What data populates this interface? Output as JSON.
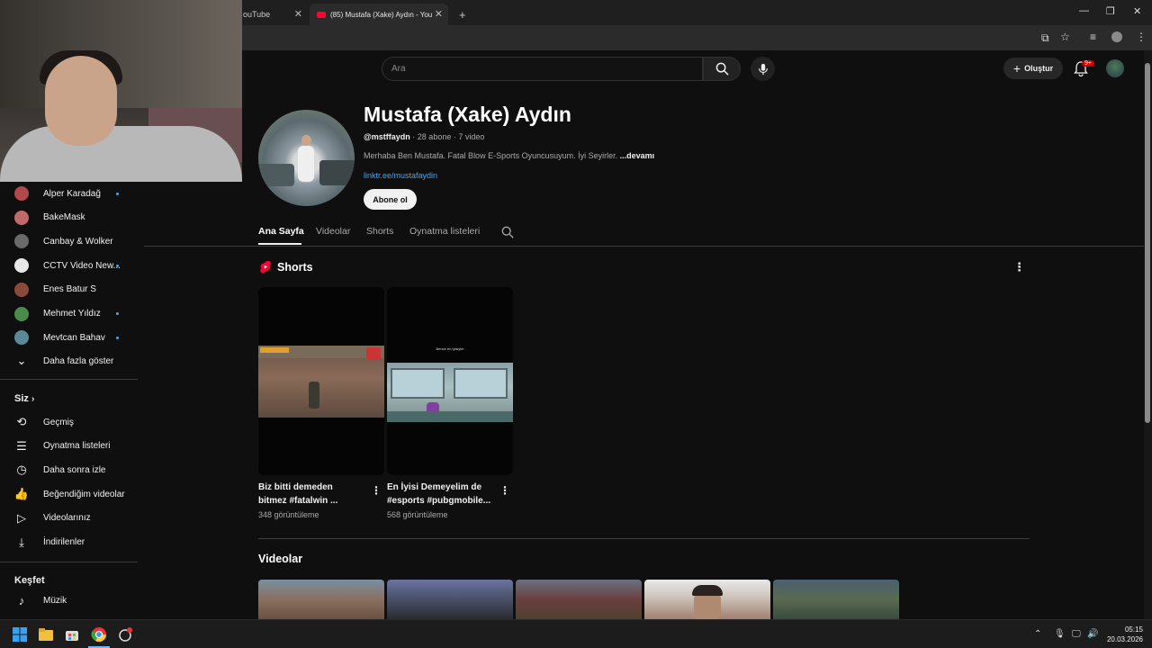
{
  "browser": {
    "tabs": [
      {
        "title": "ouTube",
        "active": false
      },
      {
        "title": "(85) Mustafa (Xake) Aydın - You",
        "active": true
      }
    ],
    "new_tab_symbol": "+",
    "window_controls": [
      "minimize-icon",
      "restore-icon",
      "close-icon"
    ]
  },
  "header": {
    "search_placeholder": "Ara",
    "create_label": "Oluştur",
    "notification_badge": "9+"
  },
  "sidebar": {
    "subscriptions": [
      {
        "label": "Alper Karadağ",
        "new": true,
        "color": "#b04a4a"
      },
      {
        "label": "BakeMask",
        "new": false,
        "color": "#c06a6a"
      },
      {
        "label": "Canbay & Wolker",
        "new": false,
        "color": "#6a6a6a"
      },
      {
        "label": "CCTV Video New...",
        "new": true,
        "color": "#e8e8e8"
      },
      {
        "label": "Enes Batur S",
        "new": false,
        "color": "#8a4a3a"
      },
      {
        "label": "Mehmet Yıldız",
        "new": true,
        "color": "#4a8a4a"
      },
      {
        "label": "Mevtcan Bahav",
        "new": true,
        "color": "#5a8a9a"
      }
    ],
    "show_more": "Daha fazla göster",
    "you_heading": "Siz",
    "you_items": [
      {
        "label": "Geçmiş",
        "icon": "history-icon"
      },
      {
        "label": "Oynatma listeleri",
        "icon": "playlists-icon"
      },
      {
        "label": "Daha sonra izle",
        "icon": "watch-later-icon"
      },
      {
        "label": "Beğendiğim videolar",
        "icon": "like-icon"
      },
      {
        "label": "Videolarınız",
        "icon": "your-videos-icon"
      },
      {
        "label": "İndirilenler",
        "icon": "download-icon"
      }
    ],
    "explore_heading": "Keşfet",
    "explore_items": [
      {
        "label": "Müzik",
        "icon": "music-icon"
      }
    ]
  },
  "channel": {
    "name": "Mustafa (Xake) Aydın",
    "handle": "@mstffaydn",
    "subscribers": "28 abone",
    "videos": "7 video",
    "description": "Merhaba Ben Mustafa. Fatal Blow E-Sports Oyuncusuyum. İyi Seyirler.",
    "more": "...devamı",
    "link": "linktr.ee/mustafaydin",
    "subscribe_label": "Abone ol",
    "tabs": [
      "Ana Sayfa",
      "Videolar",
      "Shorts",
      "Oynatma listeleri"
    ],
    "active_tab": "Ana Sayfa"
  },
  "shorts_section": {
    "title": "Shorts",
    "items": [
      {
        "title_line1": "Biz bitti demeden",
        "title_line2": "bitmez #fatalwin ...",
        "views": "348 görüntüleme"
      },
      {
        "title_line1": "En İyisi Demeyelim de",
        "title_line2": "#esports #pubgmobile...",
        "views": "568 görüntüleme",
        "overlay": "Bence en iyisiyim"
      }
    ]
  },
  "videos_section": {
    "title": "Videolar"
  },
  "taskbar": {
    "time": "05:15",
    "date": "20.03.2026"
  },
  "colors": {
    "background": "#0f0f0f",
    "accent_red": "#ff0033",
    "link_blue": "#3ea6ff"
  }
}
